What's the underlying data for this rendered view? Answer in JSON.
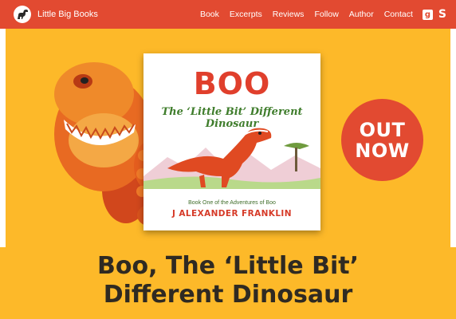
{
  "nav": {
    "brand": "Little Big Books",
    "links": [
      "Book",
      "Excerpts",
      "Reviews",
      "Follow",
      "Author",
      "Contact"
    ],
    "social_icons": [
      "goodreads-icon",
      "shopify-icon"
    ]
  },
  "book": {
    "title": "BOO",
    "subtitle": "The ‘Little Bit’ Different Dinosaur",
    "series": "Book One of the Adventures of Boo",
    "author": "J ALEXANDER FRANKLIN"
  },
  "badge": {
    "line1": "OUT",
    "line2": "NOW"
  },
  "headline": {
    "line1": "Boo, The ‘Little Bit’",
    "line2": "Different Dinosaur"
  },
  "colors": {
    "nav_bg": "#e24a31",
    "hero_bg": "#fdb929",
    "badge_bg": "#e24a31",
    "headline_text": "#2f2a22",
    "title_red": "#e03f2c",
    "subtitle_green": "#3f7d2c"
  }
}
